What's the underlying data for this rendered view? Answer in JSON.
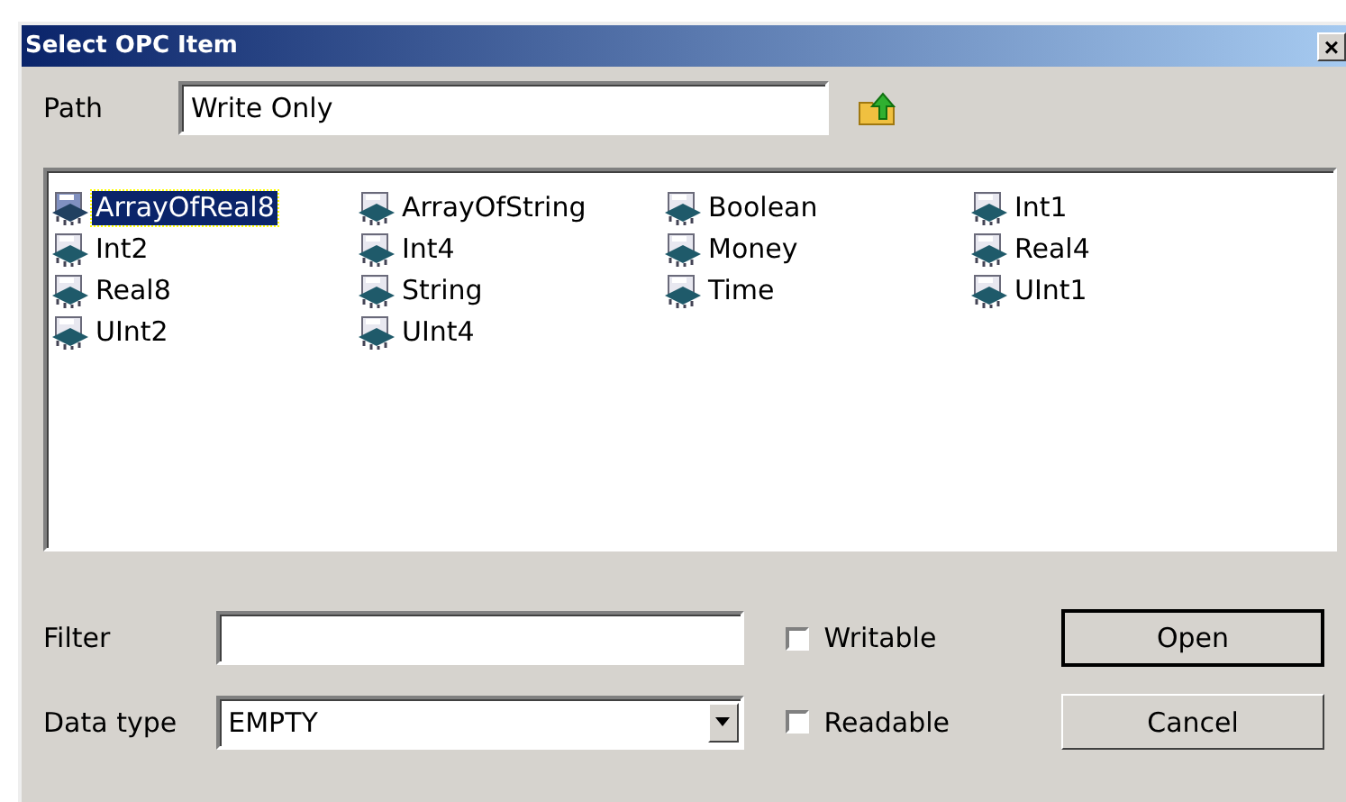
{
  "window": {
    "title": "Select OPC Item",
    "close": "×"
  },
  "path": {
    "label": "Path",
    "value": "Write Only"
  },
  "items": [
    {
      "name": "ArrayOfReal8",
      "selected": true
    },
    {
      "name": "ArrayOfString",
      "selected": false
    },
    {
      "name": "Boolean",
      "selected": false
    },
    {
      "name": "Int1",
      "selected": false
    },
    {
      "name": "Int2",
      "selected": false
    },
    {
      "name": "Int4",
      "selected": false
    },
    {
      "name": "Money",
      "selected": false
    },
    {
      "name": "Real4",
      "selected": false
    },
    {
      "name": "Real8",
      "selected": false
    },
    {
      "name": "String",
      "selected": false
    },
    {
      "name": "Time",
      "selected": false
    },
    {
      "name": "UInt1",
      "selected": false
    },
    {
      "name": "UInt2",
      "selected": false
    },
    {
      "name": "UInt4",
      "selected": false
    }
  ],
  "filter": {
    "label": "Filter"
  },
  "data_type": {
    "label": "Data type",
    "value": "EMPTY"
  },
  "checkboxes": [
    {
      "label": "Writable",
      "checked": false
    },
    {
      "label": "Readable",
      "checked": false
    }
  ],
  "buttons": [
    {
      "label": "Open",
      "default": true
    },
    {
      "label": "Cancel",
      "default": false
    }
  ]
}
